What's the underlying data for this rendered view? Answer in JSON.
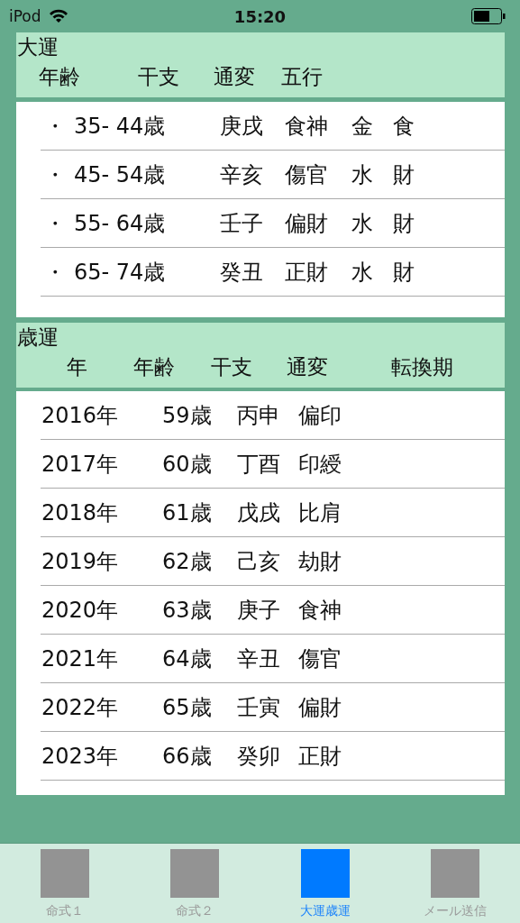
{
  "status_bar": {
    "device": "iPod",
    "time": "15:20"
  },
  "daiun": {
    "title": "大運",
    "columns": [
      "年齢",
      "干支",
      "通変",
      "五行"
    ],
    "rows": [
      {
        "bullet": "・",
        "age": "35- 44歳",
        "kanshi": "庚戌",
        "tsuhen": "食神",
        "gogyo": "金",
        "column_5": "食"
      },
      {
        "bullet": "・",
        "age": "45- 54歳",
        "kanshi": "辛亥",
        "tsuhen": "傷官",
        "gogyo": "水",
        "column_5": "財"
      },
      {
        "bullet": "・",
        "age": "55- 64歳",
        "kanshi": "壬子",
        "tsuhen": "偏財",
        "gogyo": "水",
        "column_5": "財"
      },
      {
        "bullet": "・",
        "age": "65- 74歳",
        "kanshi": "癸丑",
        "tsuhen": "正財",
        "gogyo": "水",
        "column_5": "財"
      }
    ]
  },
  "saiun": {
    "title": "歳運",
    "columns": [
      "年",
      "年齢",
      "干支",
      "通変",
      "転換期"
    ],
    "rows": [
      {
        "year": "2016年",
        "age": "59歳",
        "kanshi": "丙申",
        "tsuhen": "偏印"
      },
      {
        "year": "2017年",
        "age": "60歳",
        "kanshi": "丁酉",
        "tsuhen": "印綬"
      },
      {
        "year": "2018年",
        "age": "61歳",
        "kanshi": "戊戌",
        "tsuhen": "比肩"
      },
      {
        "year": "2019年",
        "age": "62歳",
        "kanshi": "己亥",
        "tsuhen": "劫財"
      },
      {
        "year": "2020年",
        "age": "63歳",
        "kanshi": "庚子",
        "tsuhen": "食神"
      },
      {
        "year": "2021年",
        "age": "64歳",
        "kanshi": "辛丑",
        "tsuhen": "傷官"
      },
      {
        "year": "2022年",
        "age": "65歳",
        "kanshi": "壬寅",
        "tsuhen": "偏財"
      },
      {
        "year": "2023年",
        "age": "66歳",
        "kanshi": "癸卯",
        "tsuhen": "正財"
      }
    ]
  },
  "tabs": [
    {
      "label": "命式１",
      "selected": false
    },
    {
      "label": "命式２",
      "selected": false
    },
    {
      "label": "大運歳運",
      "selected": true
    },
    {
      "label": "メール送信",
      "selected": false
    }
  ]
}
